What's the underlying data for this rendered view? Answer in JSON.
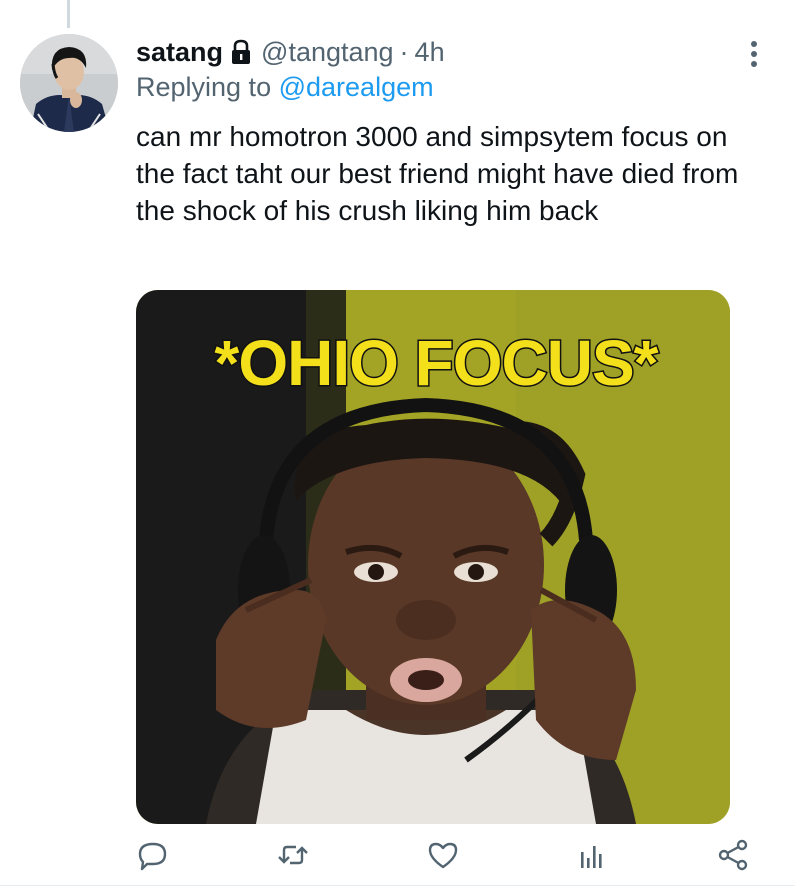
{
  "tweet": {
    "display_name": "satang",
    "handle": "@tangtang",
    "separator": "·",
    "time": "4h",
    "replying_prefix": "Replying to",
    "replying_to": "@darealgem",
    "text": "can mr homotron 3000 and simpsytem focus on the fact taht our best friend might have died from the shock of his crush liking him back"
  },
  "media": {
    "caption": "*OHIO FOCUS*"
  },
  "actions": [
    {
      "icon": "reply-icon"
    },
    {
      "icon": "retweet-icon"
    },
    {
      "icon": "like-icon"
    },
    {
      "icon": "analytics-icon"
    },
    {
      "icon": "share-icon"
    }
  ],
  "colors": {
    "accent": "#1d9bf0",
    "secondary_text": "#536471",
    "primary_text": "#0f1419",
    "meme_caption": "#f3e01b",
    "meme_background": "#a3a425"
  }
}
